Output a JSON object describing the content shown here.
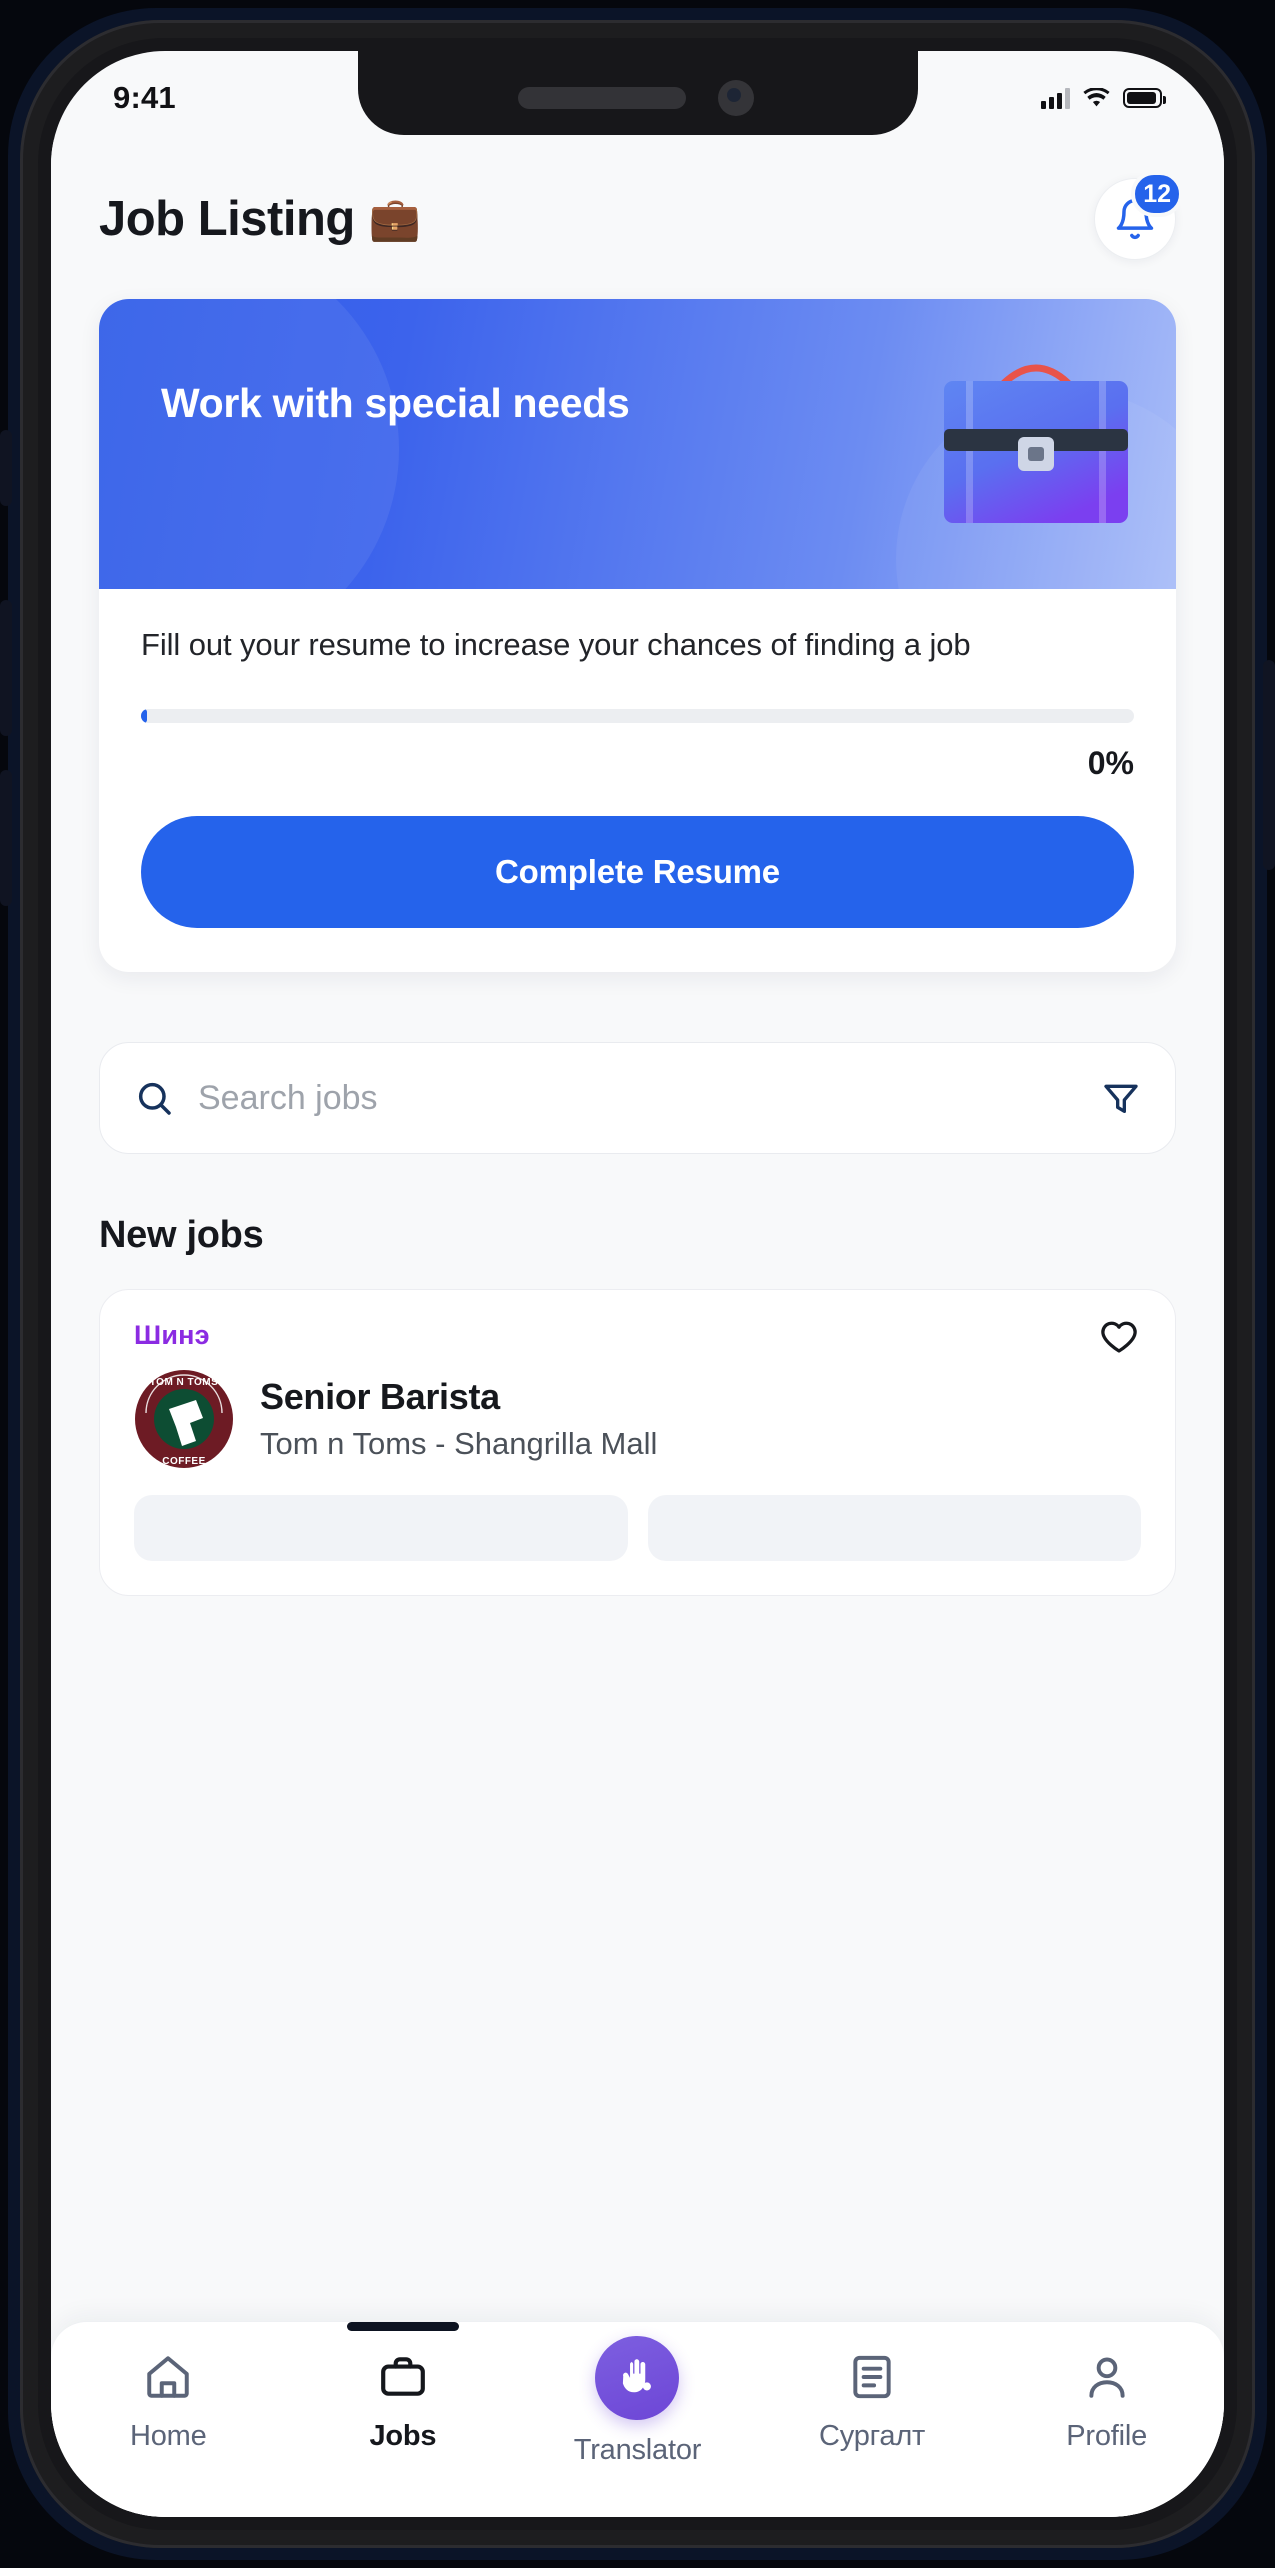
{
  "statusbar": {
    "time": "9:41",
    "signal_icon": "cellular-signal-icon",
    "wifi_icon": "wifi-icon",
    "battery_icon": "battery-full-icon"
  },
  "header": {
    "title": "Job Listing",
    "title_emoji": "💼",
    "bell_icon": "bell-icon",
    "notification_count": "12"
  },
  "resume_card": {
    "banner_title": "Work with special needs",
    "banner_art": "briefcase-illustration",
    "description": "Fill out your resume to increase your chances of finding a job",
    "progress_percent_label": "0%",
    "progress_value": 0,
    "cta_label": "Complete Resume",
    "accent_color": "#2563EB"
  },
  "search": {
    "placeholder": "Search jobs",
    "value": "",
    "search_icon": "search-icon",
    "filter_icon": "filter-icon"
  },
  "sections": {
    "new_jobs_title": "New jobs"
  },
  "job_list": [
    {
      "tag": "Шинэ",
      "tag_color": "#8B2BE2",
      "title": "Senior Barista",
      "company": "Tom n Toms - Shangrilla Mall",
      "logo": "tom-n-toms-coffee-logo",
      "logo_text_top": "TOM N TOMS",
      "logo_text_bottom": "COFFEE",
      "favorite_icon": "heart-outline-icon",
      "favorited": false
    }
  ],
  "bottom_nav": {
    "items": [
      {
        "label": "Home",
        "icon": "home-icon",
        "active": false
      },
      {
        "label": "Jobs",
        "icon": "briefcase-icon",
        "active": true
      },
      {
        "label": "Translator",
        "icon": "sign-language-icon",
        "active": false,
        "is_fab": true,
        "fab_color": "#6D46D6"
      },
      {
        "label": "Сургалт",
        "icon": "book-icon",
        "active": false
      },
      {
        "label": "Profile",
        "icon": "person-icon",
        "active": false
      }
    ]
  }
}
